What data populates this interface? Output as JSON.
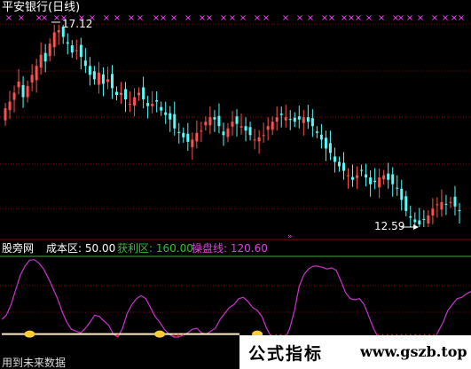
{
  "chart_title": "平安银行(日线)",
  "price_high_label": "17.12",
  "price_low_label": "12.59",
  "indicator_panel": {
    "name": "股旁网",
    "cost_label": "成本区: 50.00",
    "profit_label": "获利区: 160.00",
    "trade_label": "操盘线: 120.60"
  },
  "bottom_caption": "用到未来数据",
  "watermark": {
    "chinese": "公式指标",
    "url": "www.gszb.top"
  },
  "colors": {
    "background": "#000000",
    "up_candle": "#ff5050",
    "down_candle": "#54fcfc",
    "grid": "#8b0000",
    "marker": "#ff44ff",
    "profit_line": "#44aa44",
    "trade_line": "#cc33cc",
    "cost_line": "#ffeecc",
    "histogram": "#ff2020",
    "title": "#ffffff",
    "indicator_name": "#ffffff",
    "profit_label": "#30c030",
    "trade_label": "#e040e0"
  },
  "chart_data": [
    {
      "type": "candlestick",
      "title": "平安银行(日线)",
      "annotations": [
        "17.12",
        "12.59"
      ],
      "high": 17.12,
      "low": 12.59,
      "closes": [
        15.25,
        15.4,
        15.6,
        15.85,
        15.5,
        15.75,
        16.0,
        16.2,
        16.45,
        16.3,
        16.7,
        16.95,
        17.0,
        16.85,
        16.7,
        16.5,
        16.55,
        16.4,
        16.2,
        16.0,
        15.9,
        16.05,
        15.8,
        15.9,
        15.7,
        15.55,
        15.6,
        15.45,
        15.35,
        15.5,
        15.6,
        15.45,
        15.3,
        15.35,
        15.4,
        15.2,
        15.1,
        15.0,
        14.8,
        14.7,
        14.6,
        14.5,
        14.55,
        14.7,
        14.75,
        14.95,
        15.05,
        15.0,
        14.85,
        14.65,
        14.8,
        14.95,
        14.9,
        14.85,
        14.75,
        14.65,
        14.55,
        14.6,
        14.65,
        14.85,
        14.95,
        15.05,
        15.1,
        15.05,
        15.0,
        14.95,
        15.0,
        15.05,
        14.95,
        14.85,
        14.7,
        14.55,
        14.35,
        14.25,
        14.05,
        13.95,
        13.85,
        13.75,
        13.65,
        13.75,
        13.85,
        13.7,
        13.55,
        13.6,
        13.7,
        13.75,
        13.65,
        13.55,
        13.45,
        13.2,
        12.95,
        12.8,
        12.7,
        12.65,
        12.75,
        12.85,
        13.0,
        13.1,
        13.15,
        13.1,
        13.15,
        13.05,
        12.95
      ],
      "markers": "magenta x row at top (signal markers)"
    },
    {
      "type": "line",
      "name": "股旁网",
      "series": [
        {
          "name": "成本区",
          "constant": 50.0
        },
        {
          "name": "获利区",
          "constant": 160.0
        },
        {
          "name": "操盘线",
          "values": [
            75,
            82,
            100,
            125,
            150,
            165,
            175,
            176,
            170,
            160,
            145,
            128,
            110,
            88,
            70,
            58,
            55,
            52,
            60,
            70,
            82,
            80,
            72,
            65,
            50,
            45,
            60,
            85,
            100,
            110,
            115,
            110,
            95,
            80,
            70,
            58,
            50,
            45,
            45,
            48,
            52,
            58,
            60,
            52,
            50,
            55,
            60,
            75,
            85,
            95,
            100,
            110,
            112,
            105,
            95,
            90,
            80,
            60,
            45,
            40,
            35,
            42,
            60,
            90,
            130,
            150,
            160,
            165,
            165,
            163,
            160,
            162,
            158,
            140,
            120,
            110,
            108,
            110,
            100,
            80,
            60,
            45,
            40,
            35,
            38,
            40,
            42,
            38,
            35,
            30,
            25,
            28,
            32,
            40,
            55,
            70,
            90,
            100,
            110,
            112,
            118,
            122
          ]
        }
      ],
      "histogram": "red bars below cost line between crossings"
    }
  ]
}
